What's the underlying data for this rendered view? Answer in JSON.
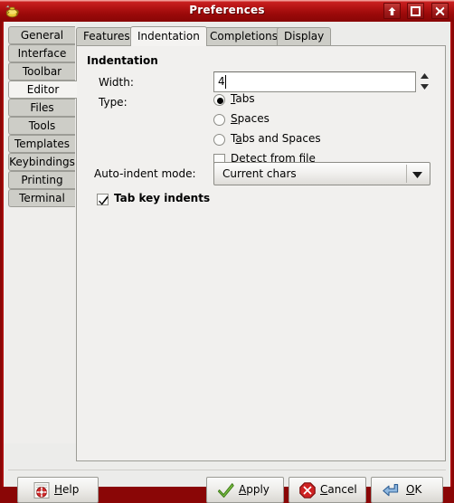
{
  "window": {
    "title": "Preferences",
    "icon": "genie-lamp-icon",
    "titlebar_color": "#a11b1b",
    "border_color": "#8a0606",
    "controls": [
      {
        "name": "shade-button",
        "icon": "arrow-up-icon"
      },
      {
        "name": "maximize-button",
        "icon": "maximize-icon"
      },
      {
        "name": "close-button",
        "icon": "close-icon"
      }
    ]
  },
  "sidebar": {
    "selected": "Editor",
    "items": [
      {
        "label": "General"
      },
      {
        "label": "Interface"
      },
      {
        "label": "Toolbar"
      },
      {
        "label": "Editor"
      },
      {
        "label": "Files"
      },
      {
        "label": "Tools"
      },
      {
        "label": "Templates"
      },
      {
        "label": "Keybindings"
      },
      {
        "label": "Printing"
      },
      {
        "label": "Terminal"
      }
    ]
  },
  "notebook": {
    "selected": "Indentation",
    "tabs": [
      {
        "label": "Features"
      },
      {
        "label": "Indentation"
      },
      {
        "label": "Completions"
      },
      {
        "label": "Display"
      }
    ]
  },
  "page": {
    "section_title": "Indentation",
    "width": {
      "label": "Width:",
      "value": "4",
      "placeholder": ""
    },
    "type": {
      "label": "Type:",
      "selected": "Tabs",
      "options": [
        {
          "label": "Tabs",
          "mnemonic_before": "",
          "mnemonic": "T",
          "mnemonic_after": "abs",
          "selected": true
        },
        {
          "label": "Spaces",
          "mnemonic_before": "",
          "mnemonic": "S",
          "mnemonic_after": "paces",
          "selected": false
        },
        {
          "label": "Tabs and Spaces",
          "mnemonic_before": "T",
          "mnemonic": "a",
          "mnemonic_after": "bs and Spaces",
          "selected": false
        }
      ]
    },
    "detect_from_file": {
      "label": "Detect from file",
      "checked": false
    },
    "auto_indent": {
      "label": "Auto-indent mode:",
      "value": "Current chars",
      "icon": "chevron-down-icon"
    },
    "tab_key_indents": {
      "label": "Tab key indents",
      "checked": true
    }
  },
  "footer": {
    "buttons": [
      {
        "name": "help-button",
        "icon": "help-lifebuoy-icon",
        "pre": "",
        "mnemonic": "H",
        "post": "elp"
      },
      {
        "name": "apply-button",
        "icon": "check-mark-icon",
        "pre": "",
        "mnemonic": "A",
        "post": "pply"
      },
      {
        "name": "cancel-button",
        "icon": "cancel-stop-icon",
        "pre": "",
        "mnemonic": "C",
        "post": "ancel"
      },
      {
        "name": "ok-button",
        "icon": "enter-arrow-icon",
        "pre": "",
        "mnemonic": "O",
        "post": "K"
      }
    ]
  }
}
